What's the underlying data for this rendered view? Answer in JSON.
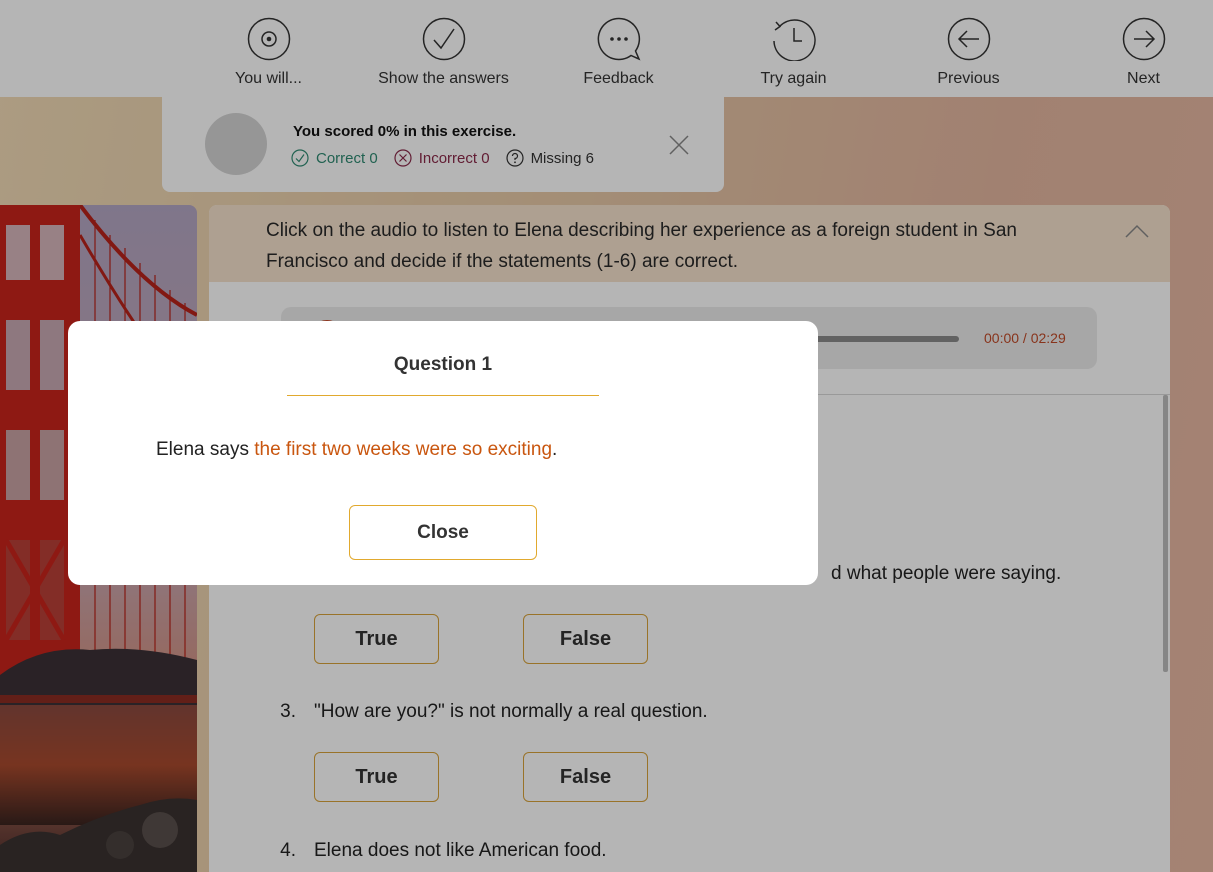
{
  "toolbar": {
    "items": [
      {
        "label": "You will...",
        "icon": "target-icon"
      },
      {
        "label": "Show the answers",
        "icon": "check-icon"
      },
      {
        "label": "Feedback",
        "icon": "speech-bubble-icon"
      },
      {
        "label": "Try again",
        "icon": "history-icon"
      },
      {
        "label": "Previous",
        "icon": "arrow-left-icon"
      },
      {
        "label": "Next",
        "icon": "arrow-right-icon"
      }
    ]
  },
  "score": {
    "title": "You scored 0% in this exercise.",
    "correct": "Correct 0",
    "incorrect": "Incorrect 0",
    "missing": "Missing 6"
  },
  "instructions": "Click on the audio to listen to Elena describing her experience as a foreign student in San Francisco and decide if the statements (1-6) are correct.",
  "audio": {
    "time": "00:00 / 02:29"
  },
  "statements": [
    {
      "num": "",
      "text": "d what people were saying."
    },
    {
      "num": "3.",
      "text": "\"How are you?\" is not normally a real question."
    },
    {
      "num": "4.",
      "text": "Elena does not like American food."
    }
  ],
  "answers": {
    "true_label": "True",
    "false_label": "False"
  },
  "modal": {
    "title": "Question 1",
    "body_prefix": "Elena says ",
    "body_highlight": "the first two weeks were so exciting",
    "body_suffix": ".",
    "close_label": "Close"
  },
  "colors": {
    "accent_gold": "#e1a92e",
    "highlight_orange": "#c9560f",
    "correct_green": "#2f8a72",
    "incorrect_maroon": "#8a2a4a"
  }
}
